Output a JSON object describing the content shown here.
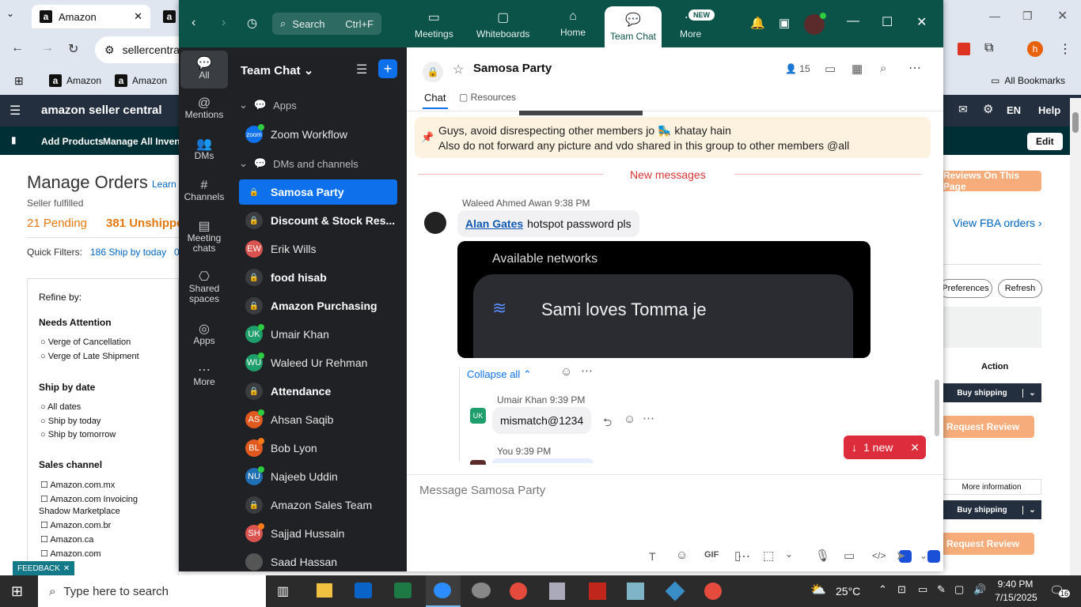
{
  "browser": {
    "tabs": [
      "Amazon"
    ],
    "address": "sellercentra",
    "bookmarks": [
      "Amazon",
      "Amazon"
    ],
    "all_bookmarks": "All Bookmarks",
    "profile": "h"
  },
  "amazon": {
    "logo": "amazon seller central",
    "nav": [
      "Add Products",
      "Manage All Inventor"
    ],
    "lang": "EN",
    "help": "Help",
    "edit": "Edit",
    "title": "Manage Orders",
    "learn": "Learn m",
    "fulfilled": "Seller fulfilled",
    "pending": "21 Pending",
    "unshipped": "381 Unshippe",
    "quick_label": "Quick Filters:",
    "quick_val": "186 Ship by today",
    "quick_extra": "0",
    "refine": "Refine by:",
    "needs": "Needs Attention",
    "needs_opts": [
      "Verge of Cancellation",
      "Verge of Late Shipment"
    ],
    "shipby": "Ship by date",
    "shipby_opts": [
      "All dates",
      "Ship by today",
      "Ship by tomorrow"
    ],
    "sales": "Sales channel",
    "sales_opts": [
      "Amazon.com.mx",
      "Amazon.com Invoicing",
      "Shadow Marketplace",
      "Amazon.com.br",
      "Amazon.ca",
      "Amazon.com"
    ],
    "feedback": "FEEDBACK",
    "reviews": "Reviews On This Page",
    "fba": "View FBA orders",
    "prefs": "Preferences",
    "refresh": "Refresh",
    "action": "Action",
    "buy": "Buy shipping",
    "req": "Request Review",
    "more_info": "More information"
  },
  "zoom": {
    "search": "Search",
    "shortcut": "Ctrl+F",
    "nav": [
      {
        "label": "Meetings"
      },
      {
        "label": "Whiteboards"
      },
      {
        "label": "Home"
      },
      {
        "label": "Team Chat"
      },
      {
        "label": "More",
        "badge": "NEW"
      }
    ],
    "rail": [
      "All",
      "Mentions",
      "DMs",
      "Channels",
      "Meeting chats",
      "Shared spaces",
      "Apps",
      "More"
    ],
    "list_title": "Team Chat",
    "sec_apps": "Apps",
    "app1": "Zoom Workflow",
    "sec_dm": "DMs and channels",
    "items": [
      {
        "name": "Samosa Party",
        "type": "lock",
        "bold": true,
        "active": true
      },
      {
        "name": "Discount & Stock Res...",
        "type": "lock",
        "bold": true
      },
      {
        "name": "Erik Wills",
        "type": "av",
        "ini": "EW",
        "color": "#d9534f"
      },
      {
        "name": "food hisab",
        "type": "lock",
        "bold": true
      },
      {
        "name": "Amazon Purchasing",
        "type": "lock",
        "bold": true
      },
      {
        "name": "Umair Khan",
        "type": "av",
        "ini": "UK",
        "color": "#1e9e6a",
        "dot": "#2ecc40"
      },
      {
        "name": "Waleed Ur Rehman",
        "type": "av",
        "ini": "WU",
        "color": "#1e9e6a",
        "dot": "#2ecc40"
      },
      {
        "name": "Attendance",
        "type": "lock",
        "bold": true
      },
      {
        "name": "Ahsan Saqib",
        "type": "av",
        "ini": "AS",
        "color": "#e05a20",
        "dot": "#2ecc40"
      },
      {
        "name": "Bob Lyon",
        "type": "av",
        "ini": "BL",
        "color": "#e05a20",
        "dot": "#ff7a1a"
      },
      {
        "name": "Najeeb Uddin",
        "type": "av",
        "ini": "NU",
        "color": "#1f6fb5",
        "dot": "#2ecc40"
      },
      {
        "name": "Amazon Sales Team",
        "type": "lock"
      },
      {
        "name": "Sajjad Hussain",
        "type": "av",
        "ini": "SH",
        "color": "#d9534f",
        "dot": "#ff7a1a"
      },
      {
        "name": "Saad Hassan",
        "type": "av",
        "ini": "",
        "color": "#555"
      }
    ],
    "channel": "Samosa Party",
    "members": "15",
    "tab_chat": "Chat",
    "tab_res": "Resources",
    "pin1": "Guys, avoid disrespecting other members jo 🛼 khatay hain",
    "pin2": "Also do not forward any picture and vdo shared in this group to other members @all",
    "new_messages": "New messages",
    "msg1_author": "Waleed Ahmed Awan",
    "msg1_time": "9:38 PM",
    "msg1_mention": "Alan Gates",
    "msg1_text": "hotspot password pls",
    "img_title": "Available networks",
    "img_net": "Sami loves Tomma je",
    "collapse": "Collapse all",
    "msg2_author": "Umair Khan",
    "msg2_time": "9:39 PM",
    "msg2_text": "mismatch@1234",
    "msg3_author": "You",
    "msg3_time": "9:39 PM",
    "new_pill": "1 new",
    "composer": "Message Samosa Party"
  },
  "taskbar": {
    "search": "Type here to search",
    "temp": "25°C",
    "time": "9:40 PM",
    "date": "7/15/2025",
    "notif": "16"
  }
}
